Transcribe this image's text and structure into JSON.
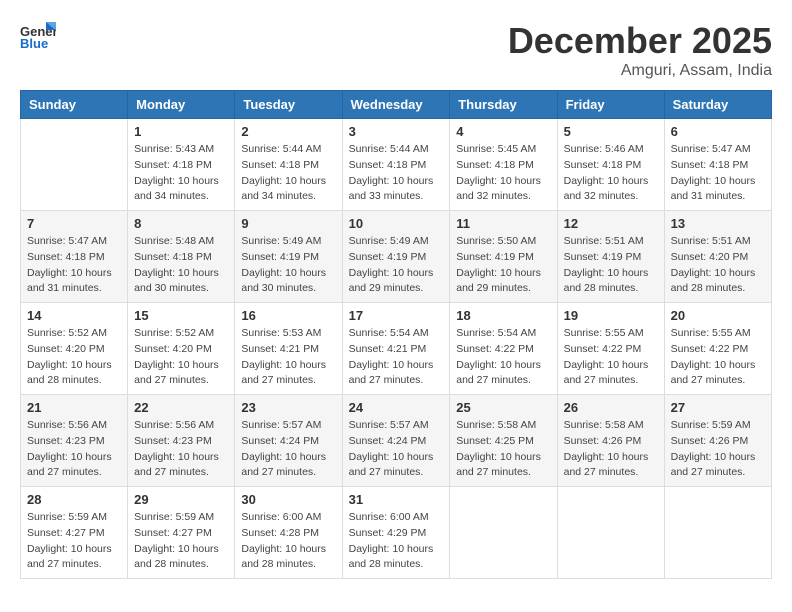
{
  "header": {
    "logo_text_general": "General",
    "logo_text_blue": "Blue",
    "month_title": "December 2025",
    "location": "Amguri, Assam, India"
  },
  "weekdays": [
    "Sunday",
    "Monday",
    "Tuesday",
    "Wednesday",
    "Thursday",
    "Friday",
    "Saturday"
  ],
  "weeks": [
    [
      {
        "day": null,
        "sunrise": null,
        "sunset": null,
        "daylight": null
      },
      {
        "day": "1",
        "sunrise": "Sunrise: 5:43 AM",
        "sunset": "Sunset: 4:18 PM",
        "daylight": "Daylight: 10 hours and 34 minutes."
      },
      {
        "day": "2",
        "sunrise": "Sunrise: 5:44 AM",
        "sunset": "Sunset: 4:18 PM",
        "daylight": "Daylight: 10 hours and 34 minutes."
      },
      {
        "day": "3",
        "sunrise": "Sunrise: 5:44 AM",
        "sunset": "Sunset: 4:18 PM",
        "daylight": "Daylight: 10 hours and 33 minutes."
      },
      {
        "day": "4",
        "sunrise": "Sunrise: 5:45 AM",
        "sunset": "Sunset: 4:18 PM",
        "daylight": "Daylight: 10 hours and 32 minutes."
      },
      {
        "day": "5",
        "sunrise": "Sunrise: 5:46 AM",
        "sunset": "Sunset: 4:18 PM",
        "daylight": "Daylight: 10 hours and 32 minutes."
      },
      {
        "day": "6",
        "sunrise": "Sunrise: 5:47 AM",
        "sunset": "Sunset: 4:18 PM",
        "daylight": "Daylight: 10 hours and 31 minutes."
      }
    ],
    [
      {
        "day": "7",
        "sunrise": "Sunrise: 5:47 AM",
        "sunset": "Sunset: 4:18 PM",
        "daylight": "Daylight: 10 hours and 31 minutes."
      },
      {
        "day": "8",
        "sunrise": "Sunrise: 5:48 AM",
        "sunset": "Sunset: 4:18 PM",
        "daylight": "Daylight: 10 hours and 30 minutes."
      },
      {
        "day": "9",
        "sunrise": "Sunrise: 5:49 AM",
        "sunset": "Sunset: 4:19 PM",
        "daylight": "Daylight: 10 hours and 30 minutes."
      },
      {
        "day": "10",
        "sunrise": "Sunrise: 5:49 AM",
        "sunset": "Sunset: 4:19 PM",
        "daylight": "Daylight: 10 hours and 29 minutes."
      },
      {
        "day": "11",
        "sunrise": "Sunrise: 5:50 AM",
        "sunset": "Sunset: 4:19 PM",
        "daylight": "Daylight: 10 hours and 29 minutes."
      },
      {
        "day": "12",
        "sunrise": "Sunrise: 5:51 AM",
        "sunset": "Sunset: 4:19 PM",
        "daylight": "Daylight: 10 hours and 28 minutes."
      },
      {
        "day": "13",
        "sunrise": "Sunrise: 5:51 AM",
        "sunset": "Sunset: 4:20 PM",
        "daylight": "Daylight: 10 hours and 28 minutes."
      }
    ],
    [
      {
        "day": "14",
        "sunrise": "Sunrise: 5:52 AM",
        "sunset": "Sunset: 4:20 PM",
        "daylight": "Daylight: 10 hours and 28 minutes."
      },
      {
        "day": "15",
        "sunrise": "Sunrise: 5:52 AM",
        "sunset": "Sunset: 4:20 PM",
        "daylight": "Daylight: 10 hours and 27 minutes."
      },
      {
        "day": "16",
        "sunrise": "Sunrise: 5:53 AM",
        "sunset": "Sunset: 4:21 PM",
        "daylight": "Daylight: 10 hours and 27 minutes."
      },
      {
        "day": "17",
        "sunrise": "Sunrise: 5:54 AM",
        "sunset": "Sunset: 4:21 PM",
        "daylight": "Daylight: 10 hours and 27 minutes."
      },
      {
        "day": "18",
        "sunrise": "Sunrise: 5:54 AM",
        "sunset": "Sunset: 4:22 PM",
        "daylight": "Daylight: 10 hours and 27 minutes."
      },
      {
        "day": "19",
        "sunrise": "Sunrise: 5:55 AM",
        "sunset": "Sunset: 4:22 PM",
        "daylight": "Daylight: 10 hours and 27 minutes."
      },
      {
        "day": "20",
        "sunrise": "Sunrise: 5:55 AM",
        "sunset": "Sunset: 4:22 PM",
        "daylight": "Daylight: 10 hours and 27 minutes."
      }
    ],
    [
      {
        "day": "21",
        "sunrise": "Sunrise: 5:56 AM",
        "sunset": "Sunset: 4:23 PM",
        "daylight": "Daylight: 10 hours and 27 minutes."
      },
      {
        "day": "22",
        "sunrise": "Sunrise: 5:56 AM",
        "sunset": "Sunset: 4:23 PM",
        "daylight": "Daylight: 10 hours and 27 minutes."
      },
      {
        "day": "23",
        "sunrise": "Sunrise: 5:57 AM",
        "sunset": "Sunset: 4:24 PM",
        "daylight": "Daylight: 10 hours and 27 minutes."
      },
      {
        "day": "24",
        "sunrise": "Sunrise: 5:57 AM",
        "sunset": "Sunset: 4:24 PM",
        "daylight": "Daylight: 10 hours and 27 minutes."
      },
      {
        "day": "25",
        "sunrise": "Sunrise: 5:58 AM",
        "sunset": "Sunset: 4:25 PM",
        "daylight": "Daylight: 10 hours and 27 minutes."
      },
      {
        "day": "26",
        "sunrise": "Sunrise: 5:58 AM",
        "sunset": "Sunset: 4:26 PM",
        "daylight": "Daylight: 10 hours and 27 minutes."
      },
      {
        "day": "27",
        "sunrise": "Sunrise: 5:59 AM",
        "sunset": "Sunset: 4:26 PM",
        "daylight": "Daylight: 10 hours and 27 minutes."
      }
    ],
    [
      {
        "day": "28",
        "sunrise": "Sunrise: 5:59 AM",
        "sunset": "Sunset: 4:27 PM",
        "daylight": "Daylight: 10 hours and 27 minutes."
      },
      {
        "day": "29",
        "sunrise": "Sunrise: 5:59 AM",
        "sunset": "Sunset: 4:27 PM",
        "daylight": "Daylight: 10 hours and 28 minutes."
      },
      {
        "day": "30",
        "sunrise": "Sunrise: 6:00 AM",
        "sunset": "Sunset: 4:28 PM",
        "daylight": "Daylight: 10 hours and 28 minutes."
      },
      {
        "day": "31",
        "sunrise": "Sunrise: 6:00 AM",
        "sunset": "Sunset: 4:29 PM",
        "daylight": "Daylight: 10 hours and 28 minutes."
      },
      {
        "day": null,
        "sunrise": null,
        "sunset": null,
        "daylight": null
      },
      {
        "day": null,
        "sunrise": null,
        "sunset": null,
        "daylight": null
      },
      {
        "day": null,
        "sunrise": null,
        "sunset": null,
        "daylight": null
      }
    ]
  ]
}
